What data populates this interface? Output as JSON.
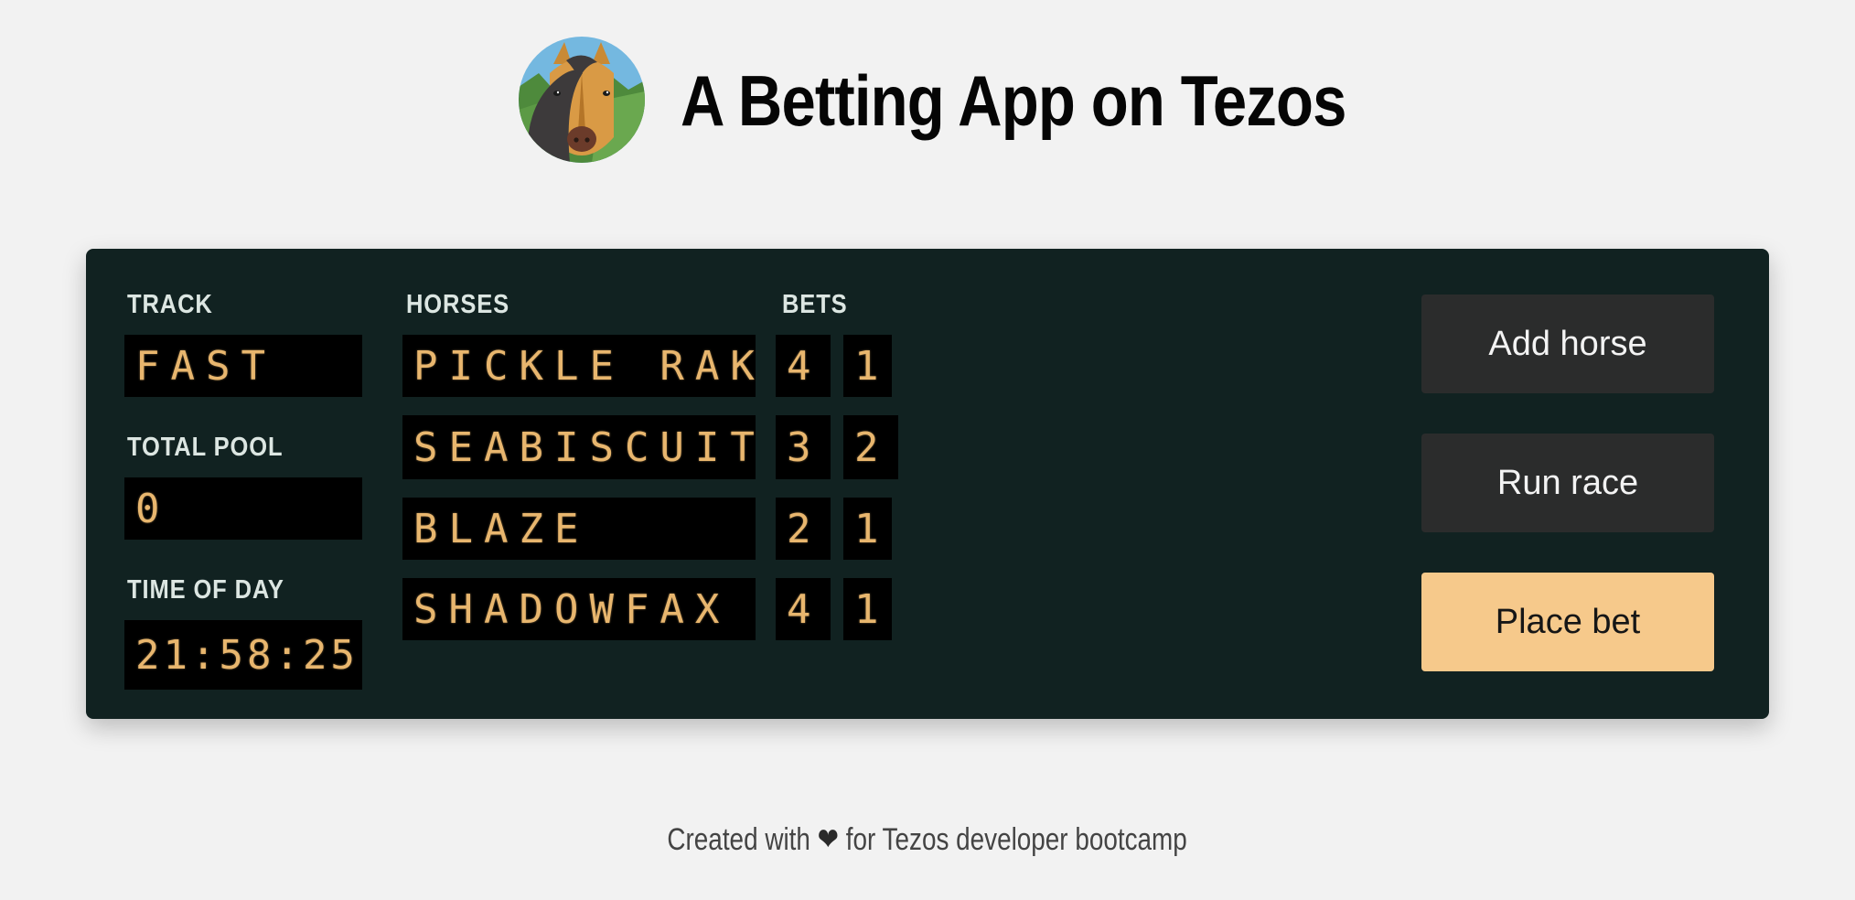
{
  "header": {
    "title": "A Betting App on Tezos",
    "logo_icon": "horse-head-logo-icon"
  },
  "board": {
    "track": {
      "label": "TRACK",
      "value": "FAST"
    },
    "total_pool": {
      "label": "TOTAL POOL",
      "value": "0"
    },
    "time_of_day": {
      "label": "TIME OF DAY",
      "value": "21:58:25"
    },
    "horses_label": "HORSES",
    "bets_label": "BETS",
    "horses": [
      {
        "name": "PICKLE RAKE",
        "bet_a": "4",
        "bet_b": "1"
      },
      {
        "name": "SEABISCUIT",
        "bet_a": "3",
        "bet_b": "2"
      },
      {
        "name": "BLAZE",
        "bet_a": "2",
        "bet_b": "1"
      },
      {
        "name": "SHADOWFAX",
        "bet_a": "4",
        "bet_b": "1"
      }
    ]
  },
  "actions": {
    "add_horse": "Add horse",
    "run_race": "Run race",
    "place_bet": "Place bet"
  },
  "footer": {
    "prefix": "Created with",
    "heart_icon": "❤",
    "suffix": "for Tezos developer bootcamp"
  },
  "colors": {
    "page_background": "#f2f2f2",
    "board_background": "#112221",
    "display_background": "#000000",
    "display_digits": "#e8b66e",
    "button_dark": "#2b2c2c",
    "button_accent": "#f6c98b"
  }
}
